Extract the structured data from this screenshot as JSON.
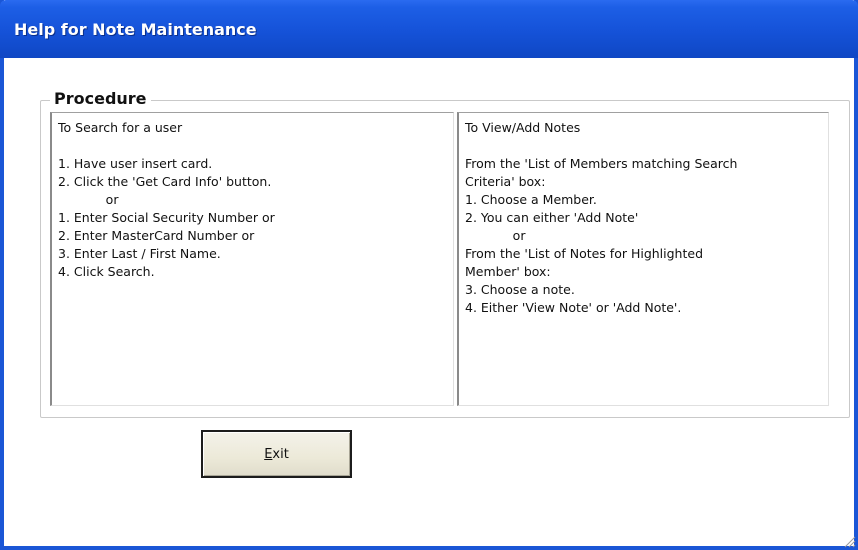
{
  "window": {
    "title": "Help for Note Maintenance"
  },
  "procedure": {
    "legend": "Procedure",
    "left_panel": {
      "lines": [
        "To Search for a user",
        "",
        "1. Have user insert card.",
        "2. Click the 'Get Card Info' button.",
        "            or",
        "1. Enter Social Security Number or",
        "2. Enter MasterCard Number or",
        "3. Enter Last / First Name.",
        "4. Click Search."
      ]
    },
    "right_panel": {
      "lines": [
        "To View/Add Notes",
        "",
        "From the 'List of Members matching Search",
        "Criteria' box:",
        "1. Choose a Member.",
        "2. You can either 'Add Note'",
        "            or",
        "From the 'List of Notes for Highlighted",
        "Member' box:",
        "3. Choose a note.",
        "4. Either 'View Note' or 'Add Note'."
      ]
    }
  },
  "buttons": {
    "exit_mnemonic": "E",
    "exit_rest": "xit"
  },
  "colors": {
    "titlebar": "#1552d8",
    "window_border": "#1a56d6",
    "button_face": "#ece9d8"
  }
}
